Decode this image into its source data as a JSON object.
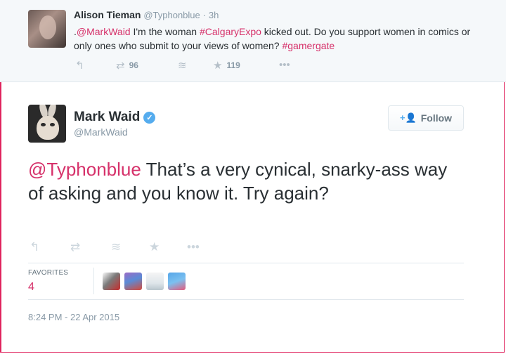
{
  "reply_tweet": {
    "name": "Alison Tieman",
    "handle": "@Typhonblue",
    "time": "3h",
    "text_parts": [
      ".",
      "@MarkWaid",
      " I'm the woman ",
      "#CalgaryExpo",
      " kicked out. Do you support women in comics or only ones who submit to your views of women? ",
      "#gamergate"
    ],
    "retweets": "96",
    "favorites": "119"
  },
  "main_tweet": {
    "name": "Mark Waid",
    "handle": "@MarkWaid",
    "verified_icon": "verified-badge-icon",
    "follow_label": "Follow",
    "mention": "@Typhonblue",
    "text": " That’s a very cynical, snarky-ass way of asking and you know it. Try again?",
    "favorites_label": "FAVORITES",
    "favorites_count": "4",
    "timestamp": "8:24 PM - 22 Apr 2015"
  },
  "icons": {
    "reply": "reply-icon",
    "retweet": "retweet-icon",
    "buffer": "buffer-icon",
    "favorite": "star-icon",
    "more": "more-icon"
  },
  "colors": {
    "link": "#d6316a",
    "verified": "#55acee",
    "muted": "#8899a6"
  }
}
